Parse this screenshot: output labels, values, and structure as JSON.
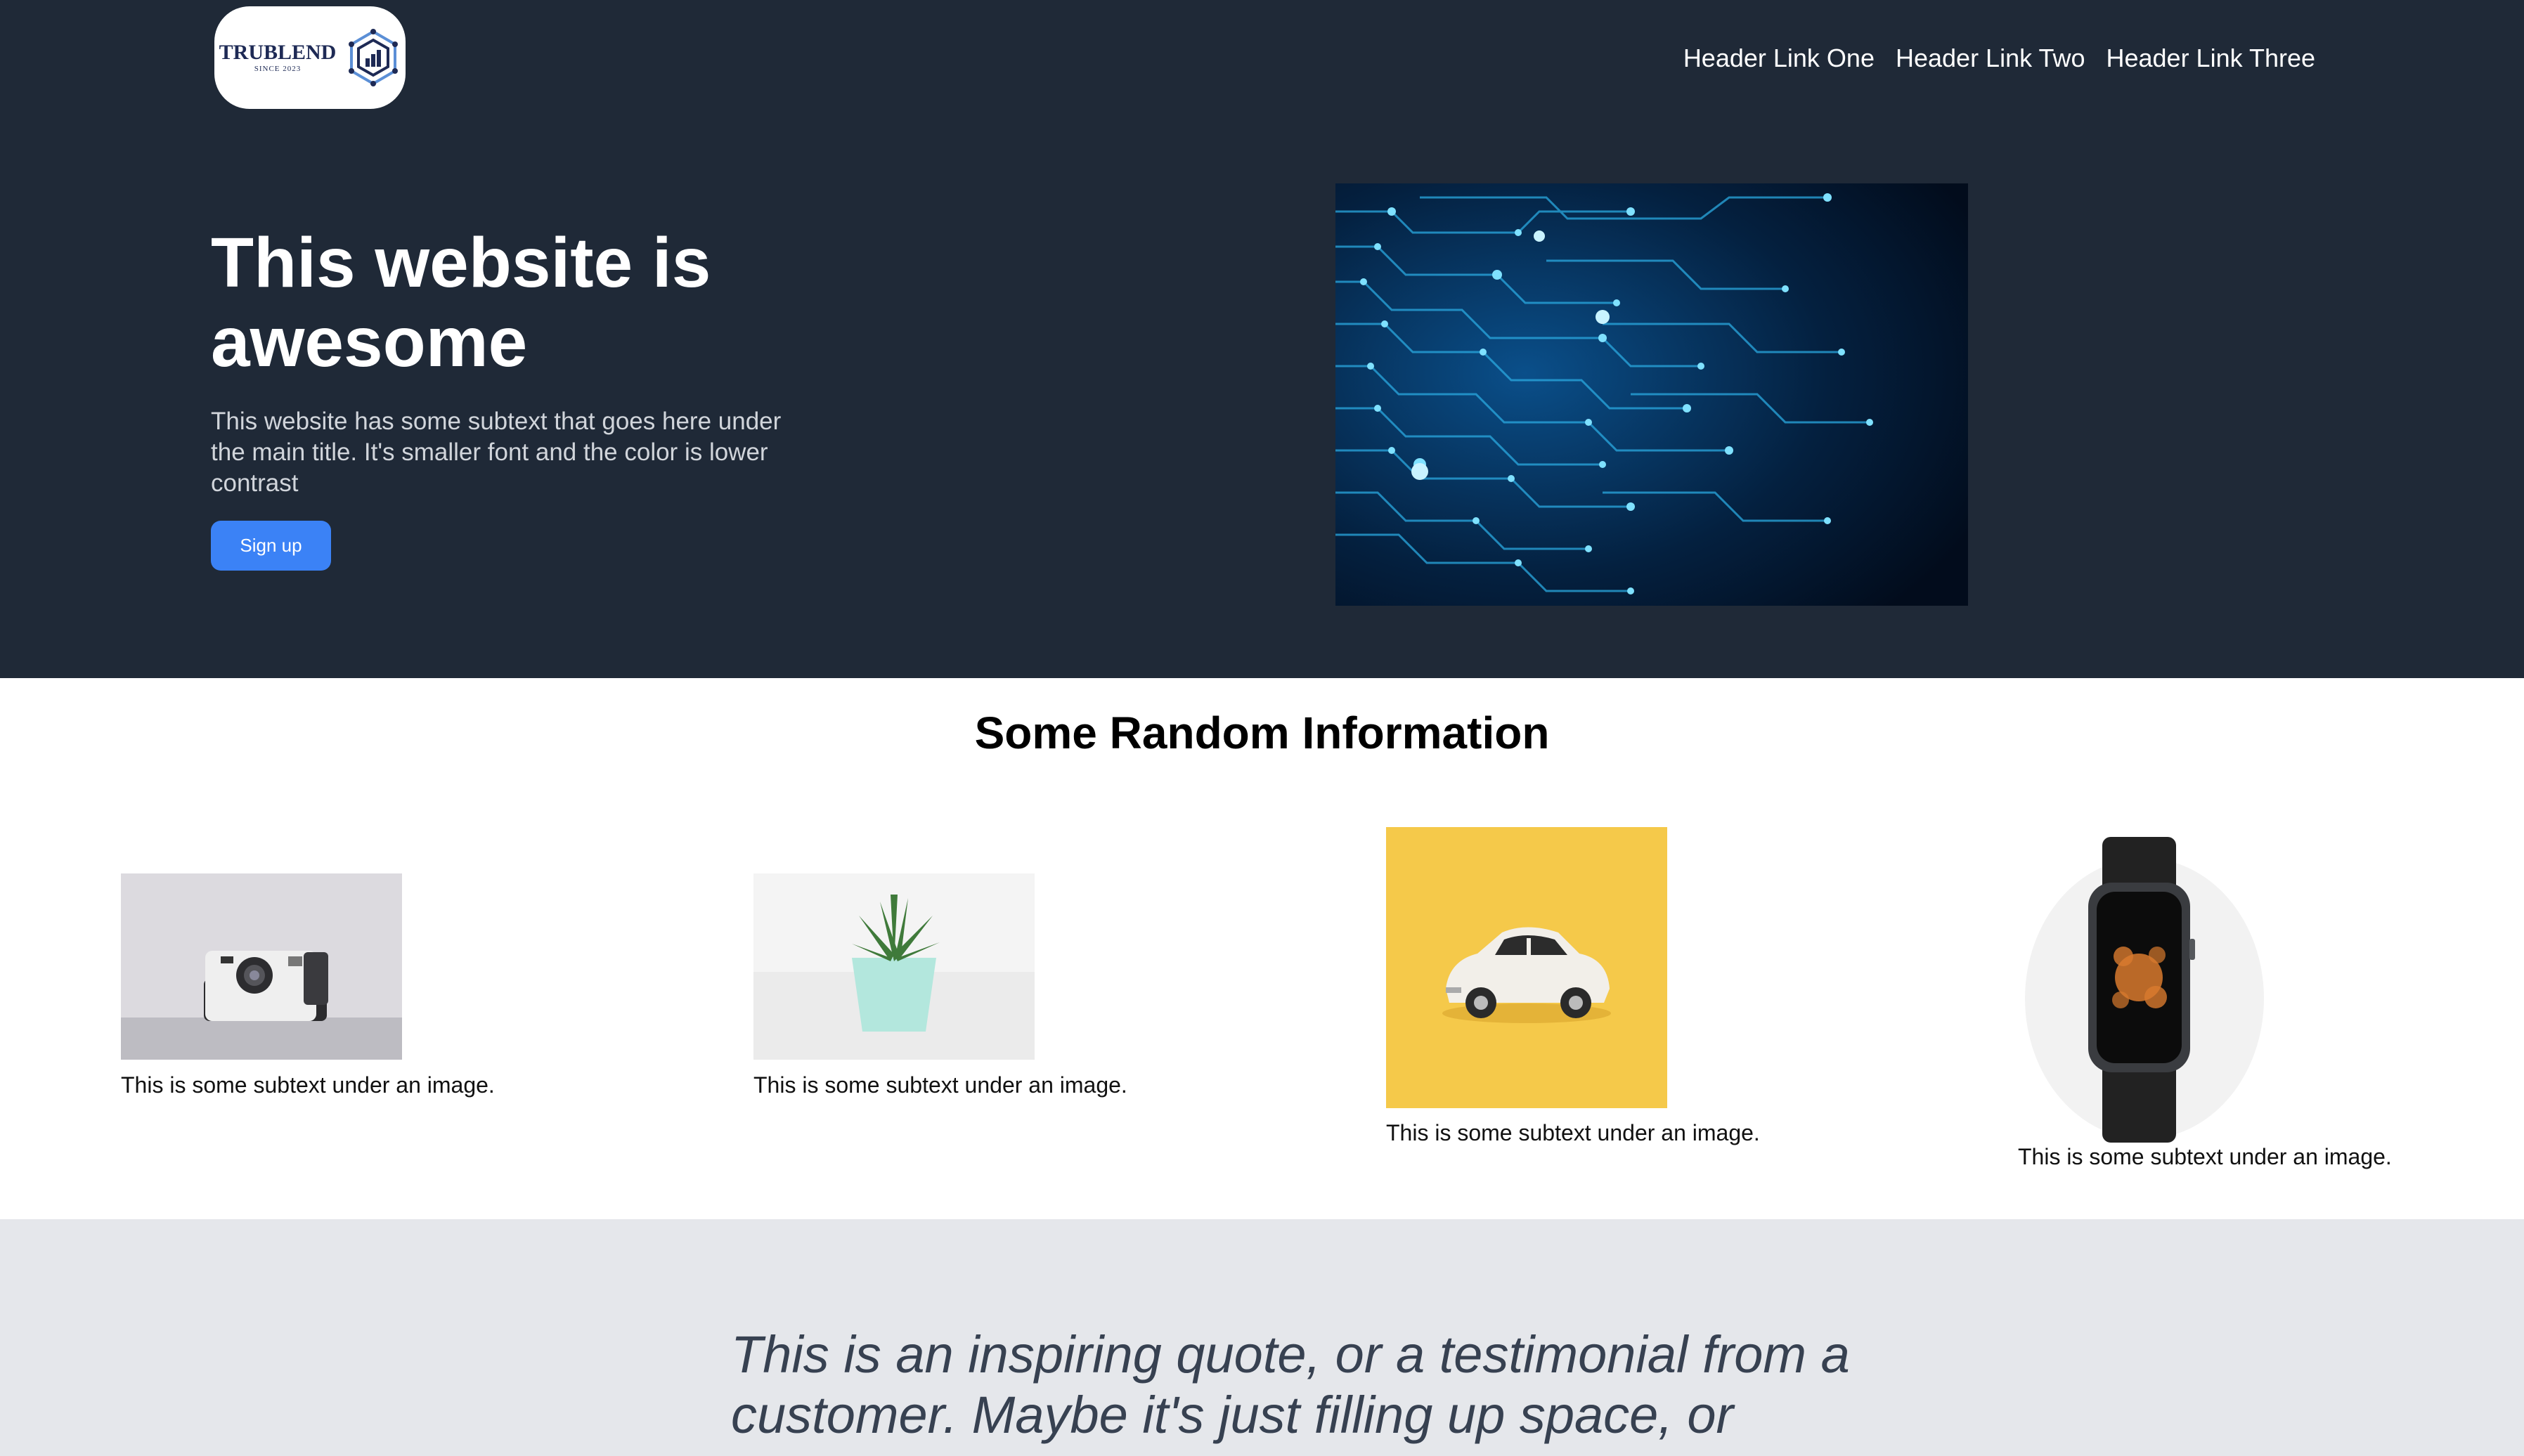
{
  "header": {
    "logo": {
      "name": "TRUBLEND",
      "tagline": "SINCE 2023"
    },
    "nav": [
      "Header Link One",
      "Header Link Two",
      "Header Link Three"
    ]
  },
  "hero": {
    "title": "This website is awesome",
    "subtitle": "This website has some subtext that goes here under the main title. It's smaller font and the color is lower contrast",
    "signup_label": "Sign up"
  },
  "info": {
    "title": "Some Random Information",
    "cards": [
      {
        "image": "polaroid-camera",
        "caption": "This is some subtext under an image."
      },
      {
        "image": "potted-succulent",
        "caption": "This is some subtext under an image."
      },
      {
        "image": "toy-car",
        "caption": "This is some subtext under an image."
      },
      {
        "image": "smart-watch",
        "caption": "This is some subtext under an image."
      }
    ]
  },
  "quote": {
    "text": "This is an inspiring quote, or a testimonial from a customer. Maybe it's just filling up space, or"
  },
  "colors": {
    "hero_bg": "#1f2937",
    "accent": "#3b82f6",
    "quote_bg": "#e5e7eb"
  }
}
